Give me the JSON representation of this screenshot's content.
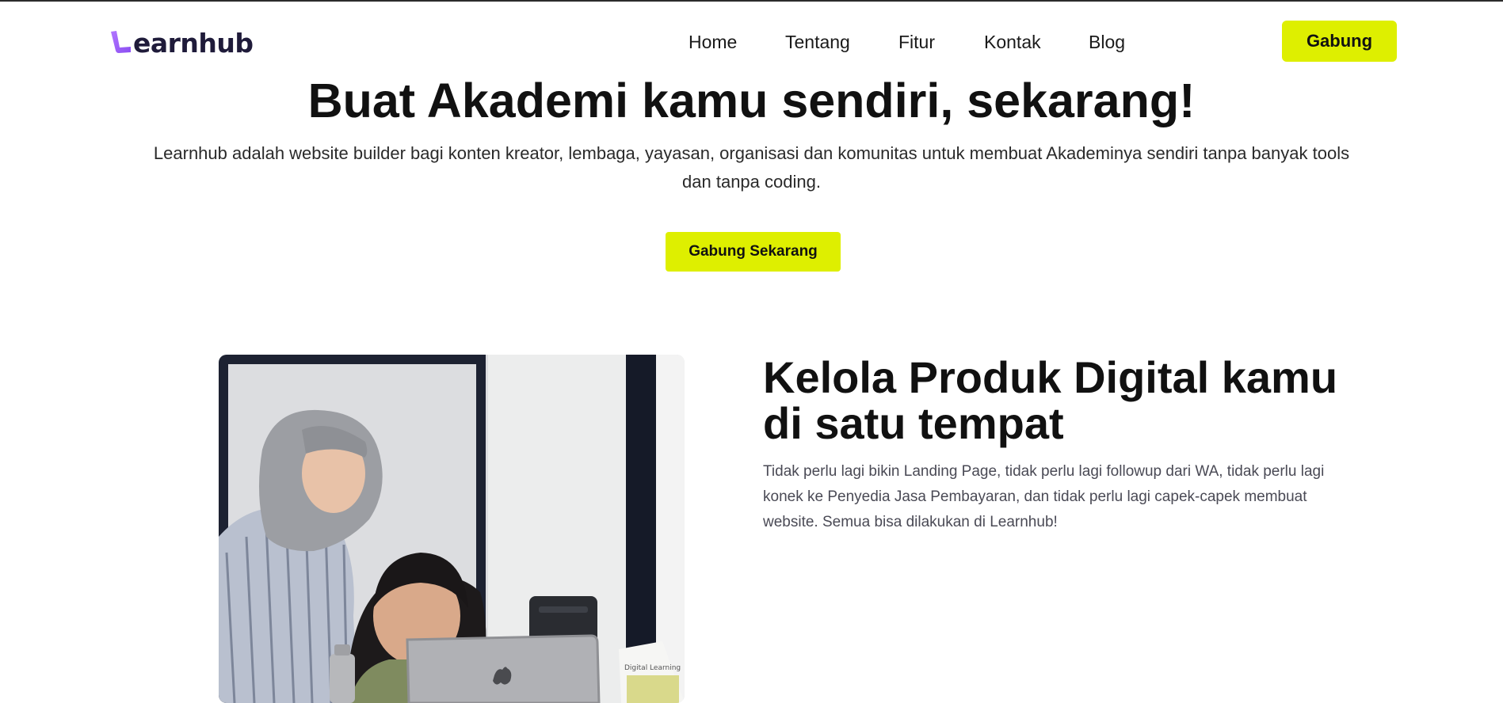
{
  "header": {
    "logo_text": "earnhub",
    "nav": {
      "home": "Home",
      "tentang": "Tentang",
      "fitur": "Fitur",
      "kontak": "Kontak",
      "blog": "Blog"
    },
    "join_label": "Gabung"
  },
  "hero": {
    "title": "Buat Akademi kamu sendiri, sekarang!",
    "description": "Learnhub adalah website builder bagi konten kreator, lembaga, yayasan, organisasi dan komunitas untuk membuat Akademinya sendiri tanpa banyak tools dan tanpa coding.",
    "cta_label": "Gabung Sekarang"
  },
  "feature": {
    "title": "Kelola Produk Digital kamu di satu tempat",
    "description": "Tidak perlu lagi bikin Landing Page, tidak perlu lagi followup dari WA, tidak perlu lagi konek ke Penyedia Jasa Pembayaran, dan tidak perlu lagi capek-capek membuat website. Semua bisa dilakukan di Learnhub!",
    "photo_calendar_text": "Digital Learning"
  },
  "colors": {
    "accent": "#deef00",
    "logo_purple": "#9b5cf6",
    "logo_text": "#1f1b3a",
    "text": "#111111"
  }
}
